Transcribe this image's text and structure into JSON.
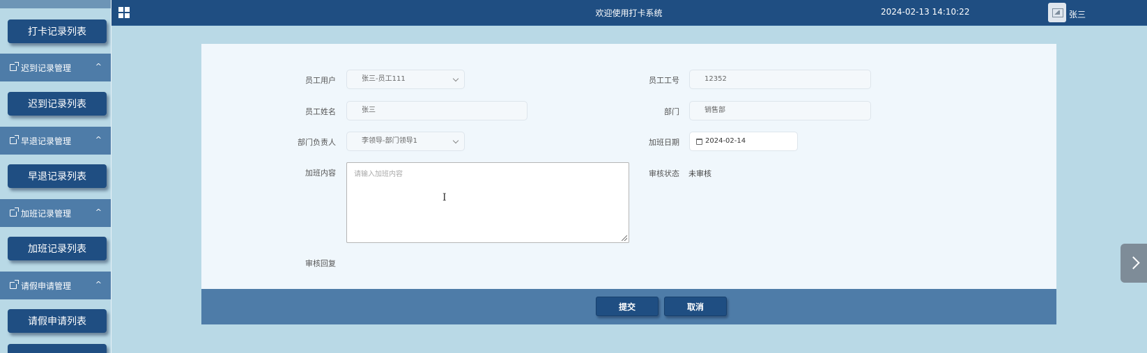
{
  "header": {
    "title": "欢迎使用打卡系统",
    "datetime": "2024-02-13 14:10:22",
    "username": "张三"
  },
  "sidebar": {
    "items": [
      {
        "type": "button",
        "label": "打卡记录列表"
      },
      {
        "type": "group",
        "label": "迟到记录管理"
      },
      {
        "type": "button",
        "label": "迟到记录列表"
      },
      {
        "type": "group",
        "label": "早退记录管理"
      },
      {
        "type": "button",
        "label": "早退记录列表"
      },
      {
        "type": "group",
        "label": "加班记录管理"
      },
      {
        "type": "button",
        "label": "加班记录列表"
      },
      {
        "type": "group",
        "label": "请假申请管理"
      },
      {
        "type": "button",
        "label": "请假申请列表"
      }
    ]
  },
  "form": {
    "employee_user": {
      "label": "员工用户",
      "value": "张三-员工111"
    },
    "employee_no": {
      "label": "员工工号",
      "value": "12352"
    },
    "employee_name": {
      "label": "员工姓名",
      "value": "张三"
    },
    "department": {
      "label": "部门",
      "value": "销售部"
    },
    "dept_leader": {
      "label": "部门负责人",
      "value": "李领导-部门领导1"
    },
    "overtime_date": {
      "label": "加班日期",
      "value": "2024-02-14"
    },
    "overtime_content": {
      "label": "加班内容",
      "placeholder": "请输入加班内容"
    },
    "review_status": {
      "label": "审核状态",
      "value": "未审核"
    },
    "review_reply": {
      "label": "审核回复"
    }
  },
  "actions": {
    "submit": "提交",
    "cancel": "取消"
  },
  "colors": {
    "header_bg": "#1f4e82",
    "page_bg": "#b9d9e6",
    "group_bg": "#4e7ca8",
    "card_bg": "#f0f7fc"
  }
}
